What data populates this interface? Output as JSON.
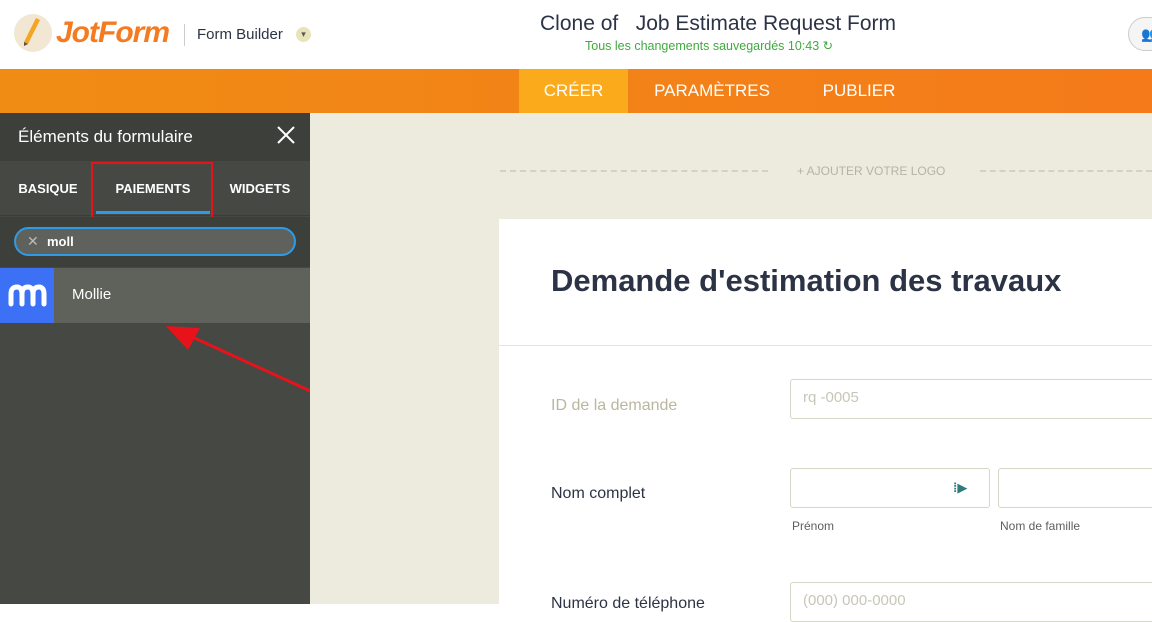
{
  "header": {
    "brand": "JotForm",
    "builder_label": "Form Builder",
    "form_title": "Clone of   Job Estimate Request Form",
    "save_status": "Tous les changements sauvegardés 10:43"
  },
  "nav": {
    "tabs": [
      {
        "label": "CRÉER",
        "active": true
      },
      {
        "label": "PARAMÈTRES",
        "active": false
      },
      {
        "label": "PUBLIER",
        "active": false
      }
    ]
  },
  "sidebar": {
    "title": "Éléments du formulaire",
    "tabs": [
      {
        "label": "BASIQUE"
      },
      {
        "label": "PAIEMENTS",
        "active": true
      },
      {
        "label": "WIDGETS"
      }
    ],
    "search_value": "moll",
    "results": [
      {
        "label": "Mollie",
        "icon": "mollie-icon",
        "icon_color": "#3c71f6"
      }
    ]
  },
  "form": {
    "add_logo": "+ AJOUTER VOTRE LOGO",
    "title": "Demande d'estimation des travaux",
    "fields": [
      {
        "label": "ID de la demande",
        "placeholder": "rq -0005",
        "disabled": true
      },
      {
        "label": "Nom complet",
        "sublabels": [
          "Prénom",
          "Nom de famille"
        ]
      },
      {
        "label": "Numéro de téléphone",
        "placeholder": "(000) 000-0000"
      }
    ]
  },
  "colors": {
    "accent_orange": "#f57a1a",
    "active_tab": "#fbaa1b",
    "highlight_red": "#e8121b",
    "focus_blue": "#2f9be7",
    "saved_green": "#3eaa3e"
  }
}
